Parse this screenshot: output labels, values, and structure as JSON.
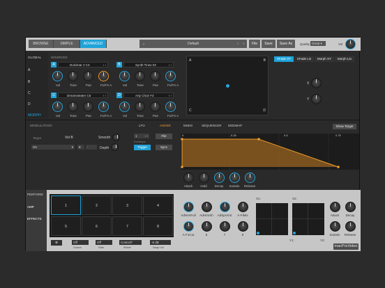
{
  "topbar": {
    "modes": [
      "BROWSE",
      "SIMPLE",
      "ADVANCED"
    ],
    "active_mode": "ADVANCED",
    "preset_name": "Default",
    "file_label": "File",
    "save_label": "Save",
    "save_as_label": "Save As",
    "quality_label": "Quality",
    "quality_value": "Great",
    "vol_label": "Vol"
  },
  "sidebar": {
    "global_label": "GLOBAL",
    "letters": [
      "A",
      "B",
      "C",
      "D"
    ],
    "morph_label": "MORPH"
  },
  "sources": {
    "title": "SOURCES",
    "items": [
      {
        "letter": "A",
        "name": "Dulcimar 2 C3",
        "labels": [
          "Vol",
          "Tone",
          "Pan",
          "F1/FX A"
        ]
      },
      {
        "letter": "B",
        "name": "Synth Tines 03",
        "labels": [
          "Vol",
          "Tone",
          "Pan",
          "F1/FX A"
        ]
      },
      {
        "letter": "C",
        "name": "Dreamsteater C6",
        "labels": [
          "Vol",
          "Tone",
          "Pan",
          "F1/FX A"
        ]
      },
      {
        "letter": "D",
        "name": "Arty Choir F3",
        "labels": [
          "Vol",
          "Tone",
          "Pan",
          "F1/FX A"
        ]
      }
    ]
  },
  "xy_pad": {
    "corners": [
      "A",
      "B",
      "C",
      "D"
    ]
  },
  "xfade": {
    "tabs": [
      "XFade XY",
      "XFade Lin",
      "Morph XY",
      "Morph Lin"
    ],
    "active_tab": "XFade XY",
    "knob_labels": [
      "X",
      "Y"
    ]
  },
  "modulation": {
    "title": "MODULATION",
    "target_label": "Target",
    "target_value": "Vol B",
    "smooth_label": "Smooth",
    "on_value": "On",
    "e_value": "E",
    "dash_value": "-",
    "depth_label": "Depth",
    "tabs": [
      "LFO",
      "AHDSR",
      "MSEG",
      "SEQUENCER",
      "MODMAP"
    ],
    "active_tab": "AHDSR",
    "show_target": "Show Target",
    "env_number": "1",
    "env_sub": "Envelope",
    "file": "File",
    "trigger": "Trigger",
    "sync": "Sync",
    "time_ticks": [
      "0",
      "0.25",
      "0.5",
      "0.75"
    ],
    "env_knobs": [
      "Attack",
      "Hold",
      "Decay",
      "Sustain",
      "Release"
    ]
  },
  "perform": {
    "tabs": [
      "PERFORM",
      "AMP",
      "EFFECTS"
    ],
    "pads": [
      "1",
      "2",
      "3",
      "4",
      "5",
      "6",
      "7",
      "8"
    ],
    "footer_values": [
      "Off",
      "Off",
      "Control7",
      "-6 dB"
    ],
    "footer_labels": [
      "Octave",
      "Rate",
      "Wheel",
      "Swap Vol"
    ],
    "macro_top": [
      "AdHrmFoil",
      "AdHrmSh",
      "AdSprAmt",
      "A-FiMix"
    ],
    "macro_bottom": [
      "A-F1Cut",
      "6",
      "7",
      "8"
    ],
    "xy_labels": [
      "X1:",
      "X2:",
      "Y1:",
      "Y2:"
    ],
    "right_knobs": [
      "Attack",
      "Decay",
      "Sustain",
      "Release"
    ]
  },
  "watermark": "macProVideo",
  "colors": {
    "accent": "#1fa3d9",
    "envelope": "#f09a2a",
    "background": "#2b2b2b"
  }
}
